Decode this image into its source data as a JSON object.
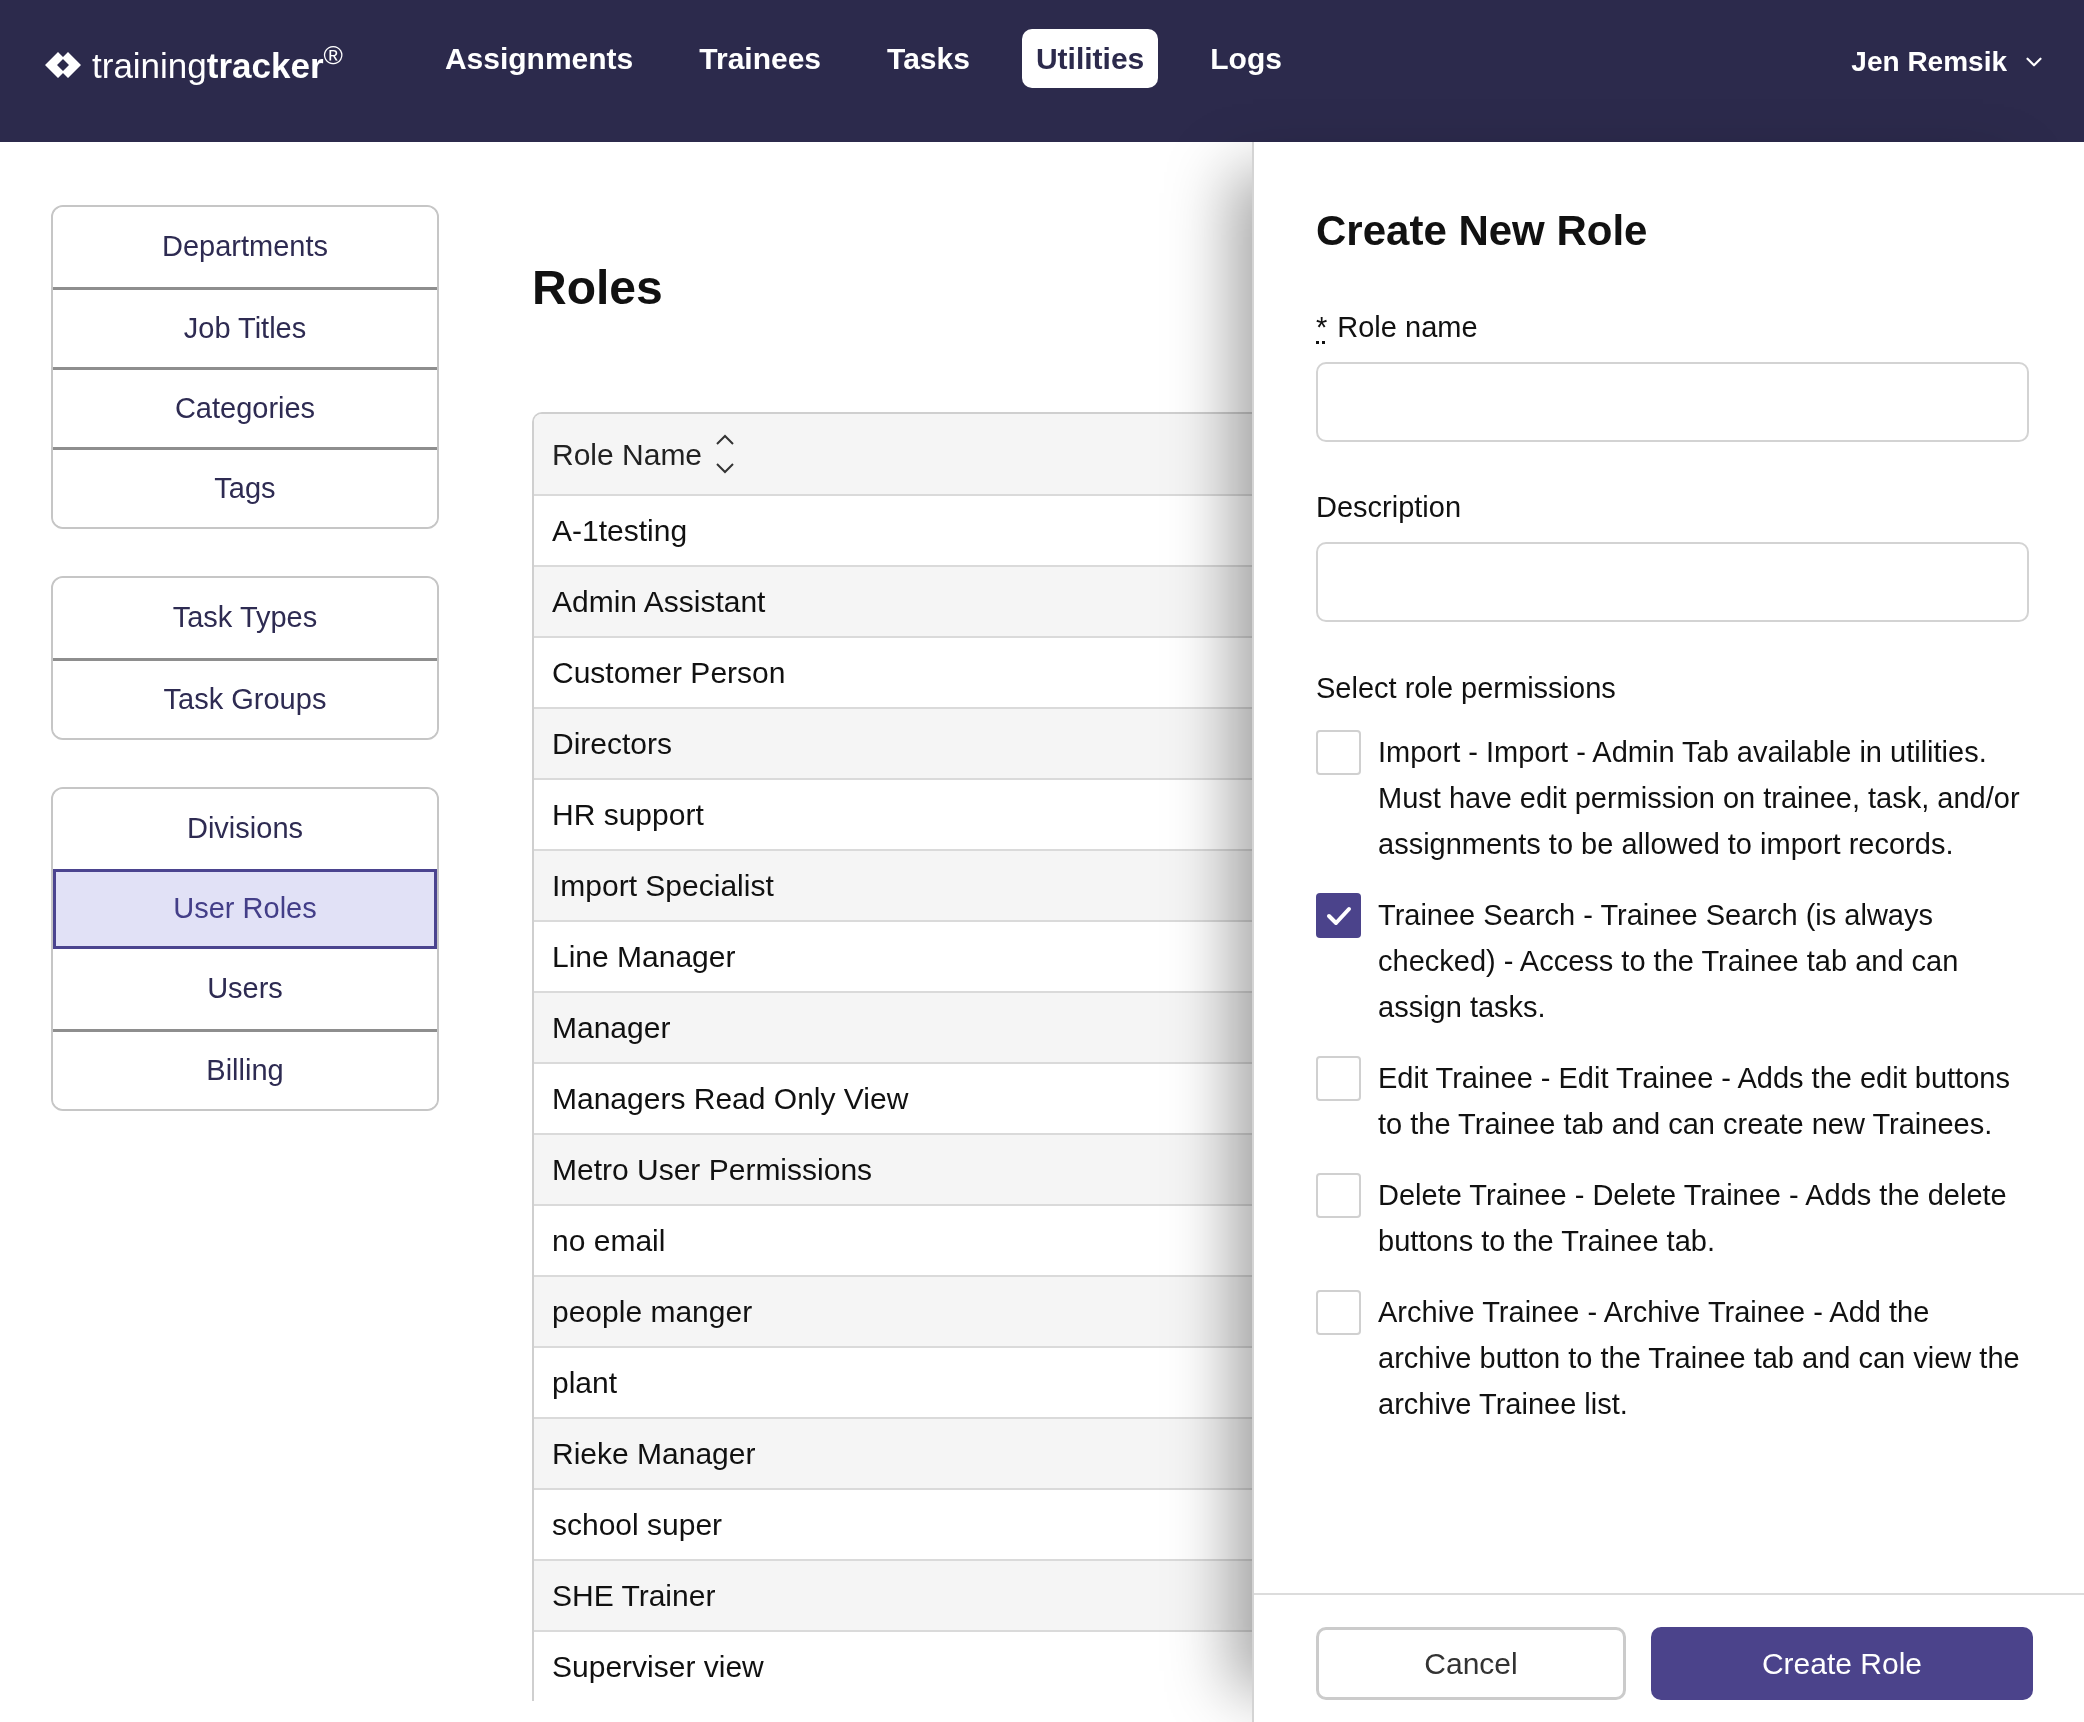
{
  "header": {
    "logo": "training**tracker**$^{®}$",
    "nav": [
      {
        "label": "Assignments",
        "selected": false
      },
      {
        "label": "Trainees",
        "selected": false
      },
      {
        "label": "Tasks",
        "selected": false
      },
      {
        "label": "Utilities",
        "selected": true
      },
      {
        "label": "Logs",
        "selected": false
      }
    ],
    "user": {
      "name": "Jen Remsik"
    }
  },
  "sidebar": {
    "groups": [
      {
        "items": [
          {
            "label": "Departments",
            "selected": false
          },
          {
            "label": "Job Titles",
            "selected": false
          },
          {
            "label": "Categories",
            "selected": false
          },
          {
            "label": "Tags",
            "selected": false
          }
        ]
      },
      {
        "items": [
          {
            "label": "Task Types",
            "selected": false
          },
          {
            "label": "Task Groups",
            "selected": false
          }
        ]
      },
      {
        "items": [
          {
            "label": "Divisions",
            "selected": false
          },
          {
            "label": "User Roles",
            "selected": true
          },
          {
            "label": "Users",
            "selected": false
          },
          {
            "label": "Billing",
            "selected": false
          }
        ]
      }
    ]
  },
  "page": {
    "title": "Roles"
  },
  "table": {
    "columns": [
      {
        "label": "Role Name",
        "sortable": true
      }
    ],
    "rows": [
      {
        "role_name": "A-1testing"
      },
      {
        "role_name": "Admin Assistant"
      },
      {
        "role_name": "Customer Person"
      },
      {
        "role_name": "Directors"
      },
      {
        "role_name": "HR support"
      },
      {
        "role_name": "Import Specialist"
      },
      {
        "role_name": "Line Manager"
      },
      {
        "role_name": "Manager"
      },
      {
        "role_name": "Managers Read Only View"
      },
      {
        "role_name": "Metro User Permissions"
      },
      {
        "role_name": "no email"
      },
      {
        "role_name": "people manger"
      },
      {
        "role_name": "plant"
      },
      {
        "role_name": "Rieke Manager"
      },
      {
        "role_name": "school super"
      },
      {
        "role_name": "SHE Trainer"
      },
      {
        "role_name": "Superviser view"
      }
    ]
  },
  "drawer": {
    "title": "Create New Role",
    "fields": [
      {
        "label": "Role name",
        "required_mark": "*"
      },
      {
        "label": "Description"
      }
    ],
    "permissions_label": "Select role permissions",
    "permissions": [
      {
        "label": "Import - Import - Admin Tab available in utilities. Must have edit permission on trainee, task, and/or assignments to be allowed to import records.",
        "checked": false
      },
      {
        "label": "Trainee Search - Trainee Search (is always checked) - Access to the Trainee tab and can assign tasks.",
        "checked": true
      },
      {
        "label": "Edit Trainee - Edit Trainee - Adds the edit buttons to the Trainee tab and can create new Trainees.",
        "checked": false
      },
      {
        "label": "Delete Trainee - Delete Trainee - Adds the delete buttons to the Trainee tab.",
        "checked": false
      },
      {
        "label": "Archive Trainee - Archive Trainee - Add the archive button to the Trainee tab and can view the archive Trainee list.",
        "checked": false
      }
    ],
    "buttons": [
      {
        "label": "Cancel",
        "kind": "secondary"
      },
      {
        "label": "Create Role",
        "kind": "primary"
      }
    ]
  }
}
